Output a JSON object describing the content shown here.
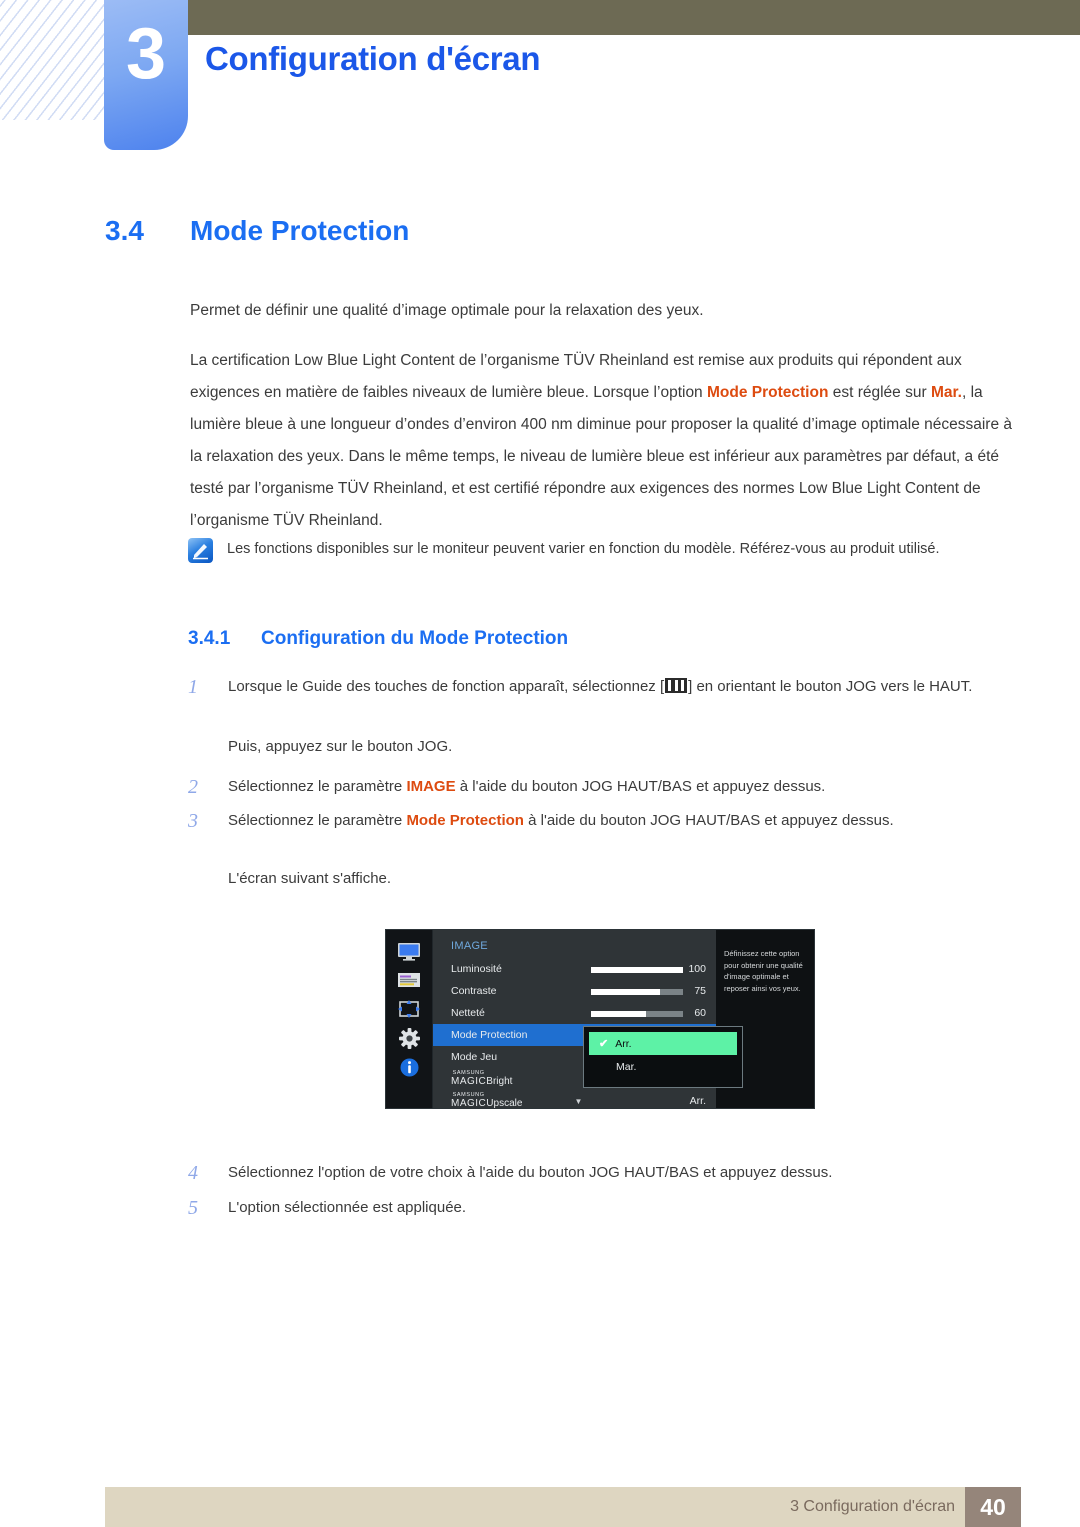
{
  "header": {
    "chapter_number": "3",
    "chapter_title": "Configuration d'écran"
  },
  "section": {
    "number": "3.4",
    "title": "Mode Protection"
  },
  "intro_paragraph": "Permet de définir une qualité d’image optimale pour la relaxation des yeux.",
  "certification_paragraph": {
    "part1": "La certification Low Blue Light Content de l’organisme TÜV Rheinland est remise aux produits qui répondent aux exigences en matière de faibles niveaux de lumière bleue. Lorsque l’option ",
    "highlight1": "Mode Protection",
    "part2": " est réglée sur ",
    "highlight2": "Mar.",
    "part3": ", la lumière bleue à une longueur d’ondes d’environ 400 nm diminue pour proposer la qualité d’image optimale nécessaire à la relaxation des yeux. Dans le même temps, le niveau de lumière bleue est inférieur aux paramètres par défaut, a été testé par l’organisme TÜV Rheinland, et est certifié répondre aux exigences des normes Low Blue Light Content de l’organisme TÜV Rheinland."
  },
  "note": {
    "icon": "note-pencil-icon",
    "text": "Les fonctions disponibles sur le moniteur peuvent varier en fonction du modèle. Référez-vous au produit utilisé."
  },
  "subsection": {
    "number": "3.4.1",
    "title": "Configuration du Mode Protection"
  },
  "steps": [
    {
      "num": "1",
      "part1": "Lorsque le Guide des touches de fonction apparaît, sélectionnez [",
      "icon": "jog-button-icon",
      "part2": "] en orientant le bouton JOG vers le HAUT.",
      "follow_up": "Puis, appuyez sur le bouton JOG."
    },
    {
      "num": "2",
      "part1": "Sélectionnez le paramètre ",
      "highlight": "IMAGE",
      "part2": " à l'aide du bouton JOG HAUT/BAS et appuyez dessus."
    },
    {
      "num": "3",
      "part1": "Sélectionnez le paramètre ",
      "highlight": "Mode Protection",
      "part2": " à l'aide du bouton JOG HAUT/BAS et appuyez dessus.",
      "follow_up": "L'écran suivant s'affiche."
    },
    {
      "num": "4",
      "part1": "Sélectionnez l'option de votre choix à l'aide du bouton JOG HAUT/BAS et appuyez dessus."
    },
    {
      "num": "5",
      "part1": "L'option sélectionnée est appliquée."
    }
  ],
  "osd": {
    "title": "IMAGE",
    "sidebar_icons": [
      "monitor-icon",
      "osd-menu-icon",
      "pip-move-icon",
      "gear-icon",
      "info-icon"
    ],
    "rows": [
      {
        "label": "Luminosité",
        "value": "100",
        "slider_percent": 100
      },
      {
        "label": "Contraste",
        "value": "75",
        "slider_percent": 75
      },
      {
        "label": "Netteté",
        "value": "60",
        "slider_percent": 60
      },
      {
        "label": "Mode Protection",
        "value": "",
        "selected": true
      },
      {
        "label": "Mode Jeu",
        "value": ""
      },
      {
        "label_magic": "SAMSUNG",
        "label_magic2": "MAGIC",
        "label_suffix": "Bright",
        "value": ""
      },
      {
        "label_magic": "SAMSUNG",
        "label_magic2": "MAGIC",
        "label_suffix": "Upscale",
        "value": "Arr."
      }
    ],
    "dropdown": {
      "options": [
        "Arr.",
        "Mar."
      ],
      "selected": "Arr.",
      "check_icon": "check-icon"
    },
    "help_text": "Définissez cette option pour obtenir une qualité d'image optimale et reposer ainsi vos yeux.",
    "scroll_caret": "▼",
    "colors": {
      "selected_row": "#1f6fd0",
      "dropdown_active": "#5df2a6",
      "panel": "#2f3437"
    }
  },
  "footer": {
    "text": "3 Configuration d'écran",
    "page_number": "40"
  },
  "colors": {
    "accent_blue": "#1b6ef2",
    "highlight_orange": "#dd4b10",
    "header_olive": "#6d6a54",
    "footer_beige": "#ded6c1",
    "footer_page_brown": "#95857a"
  }
}
